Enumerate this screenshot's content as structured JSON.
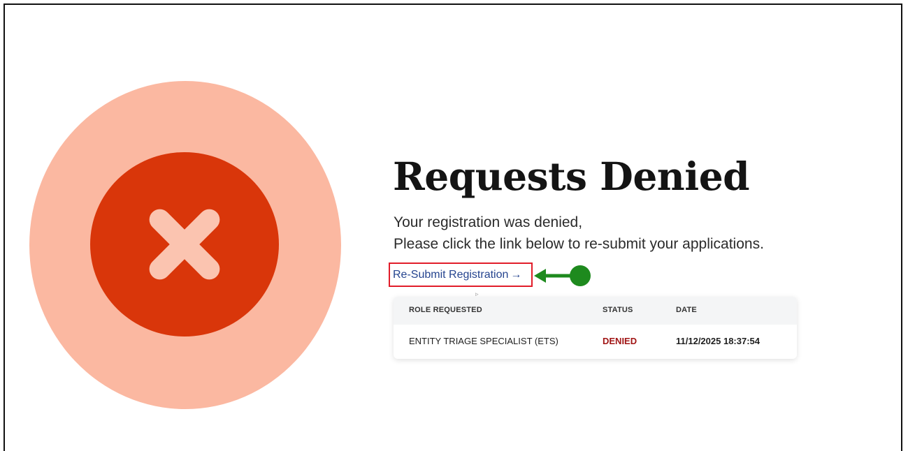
{
  "page": {
    "title": "Requests Denied",
    "message_line1": "Your registration was denied,",
    "message_line2": "Please click the link below to re-submit your applications.",
    "resubmit_link": {
      "label": "Re-Submit Registration",
      "arrow": "→"
    }
  },
  "icons": {
    "status": "error-x-icon",
    "annotation": "green-arrow-pointer"
  },
  "colors": {
    "outer_circle": "#fbb8a1",
    "inner_circle": "#d9360a",
    "link": "#25448f",
    "highlight_box": "#e11d2a",
    "annotation": "#1e8a1e",
    "denied_status": "#a11616"
  },
  "table": {
    "columns": [
      "ROLE REQUESTED",
      "STATUS",
      "DATE"
    ],
    "rows": [
      {
        "role": "ENTITY TRIAGE SPECIALIST (ETS)",
        "status": "DENIED",
        "date": "11/12/2025 18:37:54"
      }
    ]
  }
}
